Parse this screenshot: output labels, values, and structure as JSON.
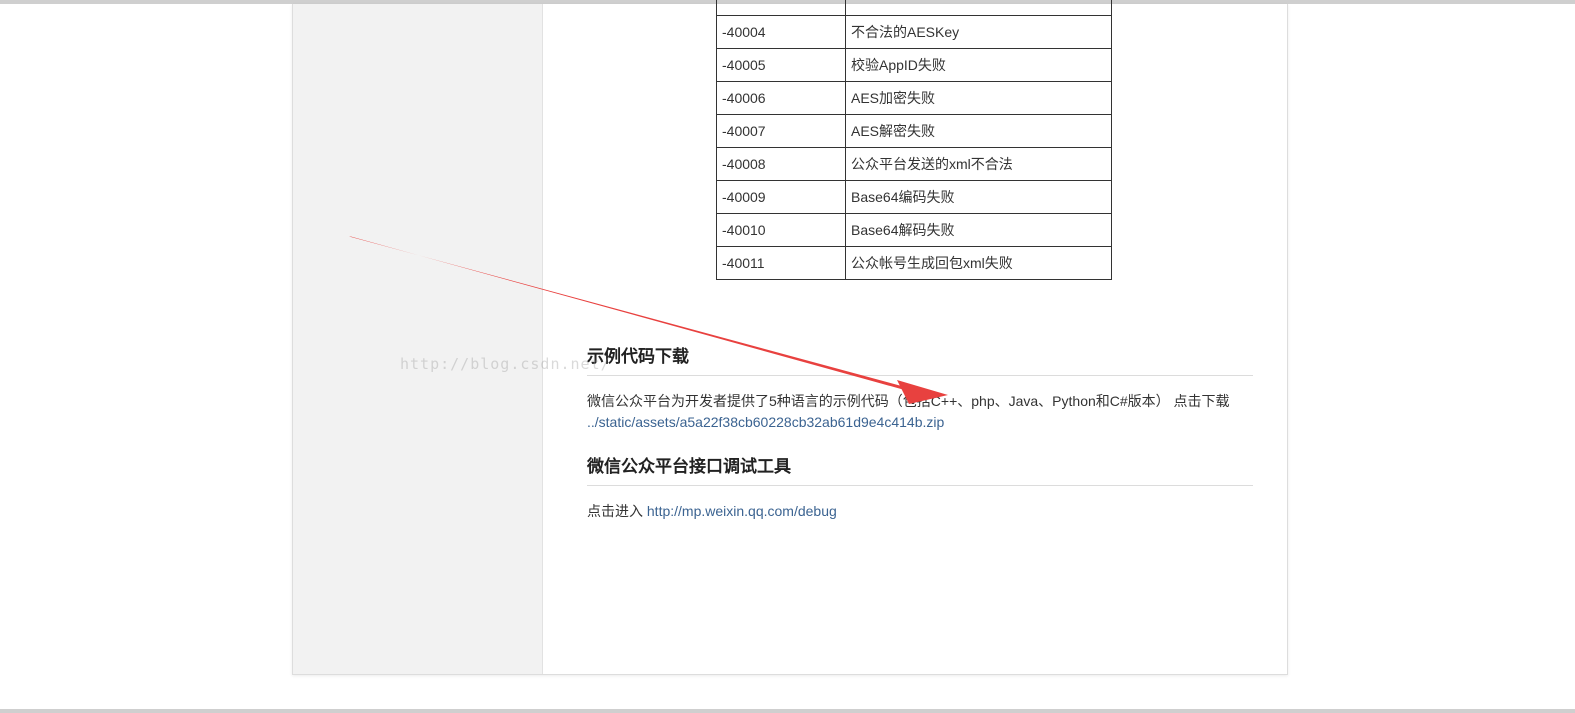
{
  "error_table": {
    "rows": [
      {
        "code": "-40004",
        "desc": "不合法的AESKey"
      },
      {
        "code": "-40005",
        "desc": "校验AppID失败"
      },
      {
        "code": "-40006",
        "desc": "AES加密失败"
      },
      {
        "code": "-40007",
        "desc": "AES解密失败"
      },
      {
        "code": "-40008",
        "desc": "公众平台发送的xml不合法"
      },
      {
        "code": "-40009",
        "desc": "Base64编码失败"
      },
      {
        "code": "-40010",
        "desc": "Base64解码失败"
      },
      {
        "code": "-40011",
        "desc": "公众帐号生成回包xml失败"
      }
    ]
  },
  "sample_section": {
    "title": "示例代码下载",
    "text": "微信公众平台为开发者提供了5种语言的示例代码（包括C++、php、Java、Python和C#版本） 点击下载",
    "link": "../static/assets/a5a22f38cb60228cb32ab61d9e4c414b.zip"
  },
  "debug_section": {
    "title": "微信公众平台接口调试工具",
    "text": "点击进入 ",
    "link": "http://mp.weixin.qq.com/debug"
  },
  "watermark": "http://blog.csdn.net/",
  "annotation": {
    "color": "#e8413f",
    "icon": "red-arrow-annotation"
  }
}
